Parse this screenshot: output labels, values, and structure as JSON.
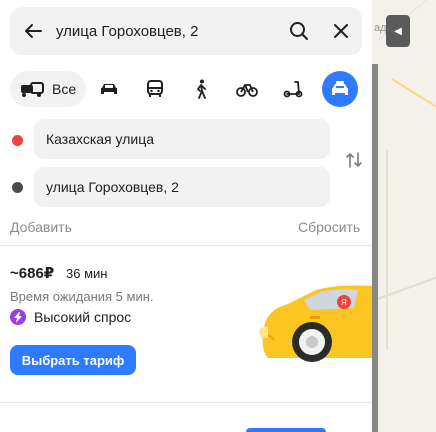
{
  "map": {
    "label_fragment": "адьба",
    "collapse_icon": "triangle-left-icon"
  },
  "search": {
    "query": "улица Гороховцев, 2",
    "back_icon": "arrow-left-icon",
    "search_icon": "search-icon",
    "clear_icon": "close-icon"
  },
  "modes": {
    "all_label": "Все",
    "items": [
      "car-icon",
      "bus-icon",
      "walk-icon",
      "bike-icon",
      "scooter-icon",
      "taxi-icon"
    ],
    "active": "taxi-icon",
    "active_color": "#2f7bff"
  },
  "route": {
    "from": {
      "label": "Казахская улица",
      "dot_color": "#f0413c"
    },
    "to": {
      "label": "улица Гороховцев, 2",
      "dot_color": "#4a4a4a"
    },
    "swap_icon": "swap-icon",
    "add_label": "Добавить",
    "reset_label": "Сбросить"
  },
  "taxi": {
    "price": "~686₽",
    "duration": "36 мин",
    "wait": "Время ожидания 5 мин.",
    "demand_label": "Высокий спрос",
    "demand_color": "#9c3fe0",
    "choose_label": "Выбрать тариф",
    "car_color": "#fcc521"
  }
}
